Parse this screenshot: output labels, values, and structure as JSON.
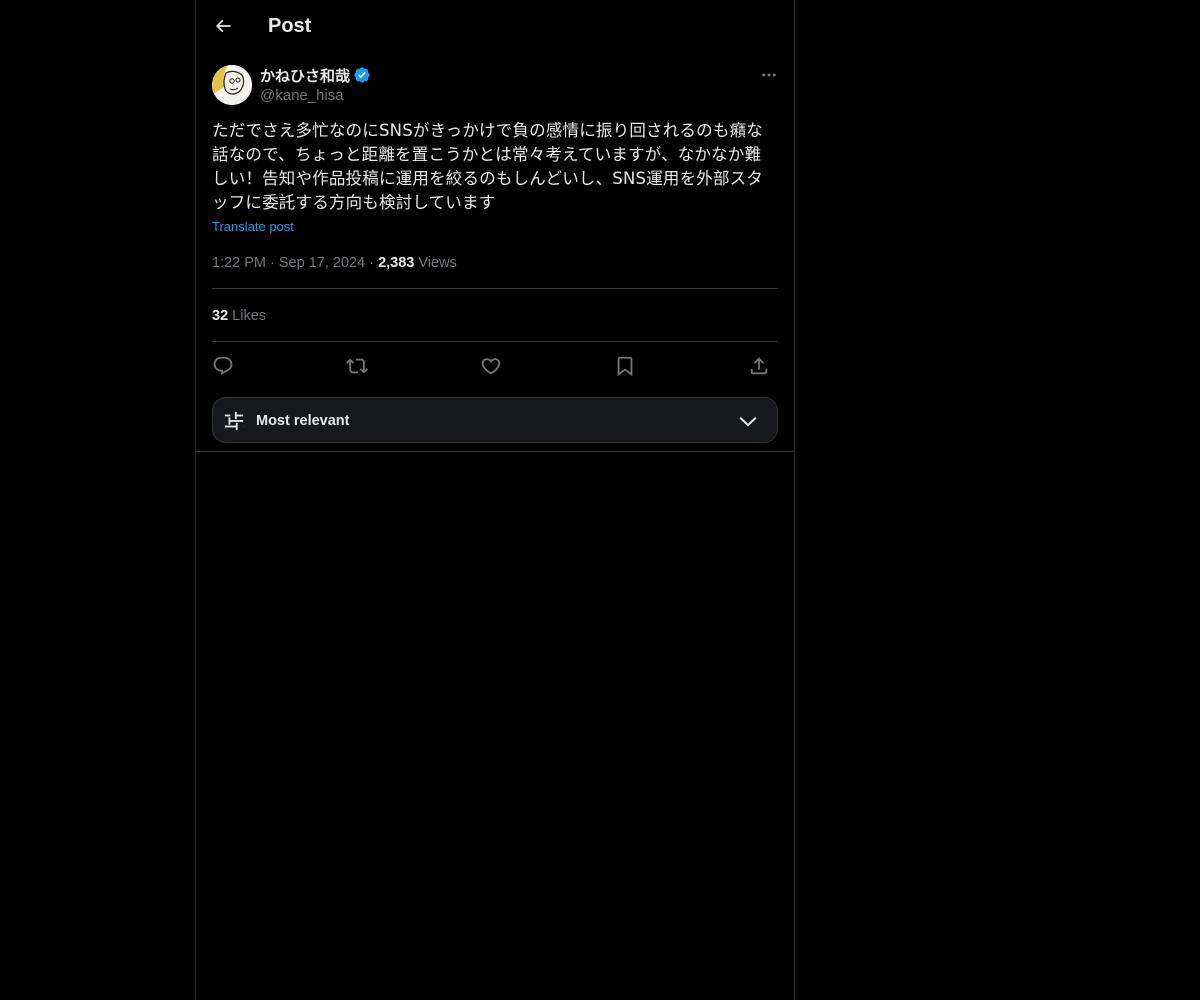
{
  "header": {
    "title": "Post",
    "back_icon": "arrow-left-icon"
  },
  "post": {
    "author": {
      "name": "かねひさ和哉",
      "handle": "@kane_hisa",
      "verified": true,
      "verified_color": "#1d9bf0"
    },
    "text": "ただでさえ多忙なのにSNSがきっかけで負の感情に振り回されるのも癪な\n話なので、ちょっと距離を置こうかとは常々考えていますが、なかなか難\nしい！告知や作品投稿に運用を絞るのもしんどいし、SNS運用を外部スタ\nッフに委託する方向も検討しています",
    "translate_label": "Translate post",
    "time": "1:22 PM",
    "date": "Sep 17, 2024",
    "views_count": "2,383",
    "views_label": "Views",
    "likes_count": "32",
    "likes_label": "Likes",
    "actions": [
      "reply-icon",
      "repost-icon",
      "like-icon",
      "bookmark-icon",
      "share-icon"
    ]
  },
  "replies_sort": {
    "label": "Most relevant",
    "icon": "sliders-icon",
    "expand_icon": "chevron-down-icon"
  },
  "colors": {
    "background": "#000000",
    "text_primary": "#e7e9ea",
    "text_secondary": "#71767b",
    "accent": "#1d9bf0",
    "border": "#2f3336"
  }
}
